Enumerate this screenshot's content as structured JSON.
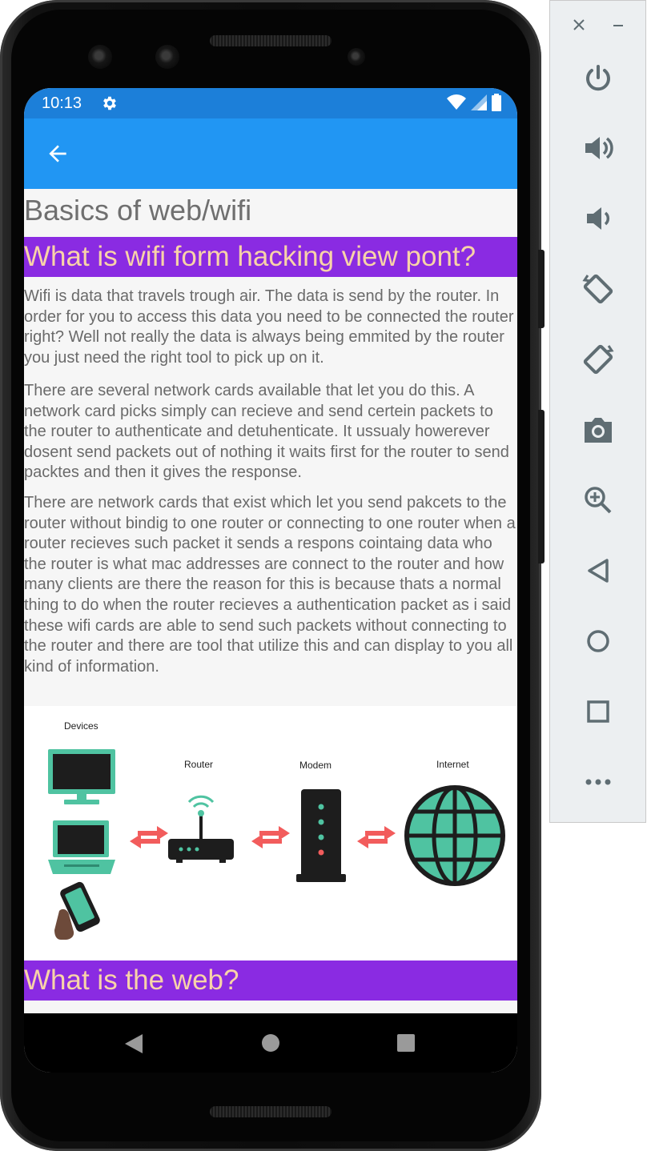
{
  "status_bar": {
    "time": "10:13"
  },
  "content": {
    "page_title": "Basics of web/wifi",
    "sections": [
      {
        "heading": "What is wifi form hacking view pont?",
        "paragraphs": [
          "Wifi is data that travels trough air. The data is send by the router. In order for you to access this data you need to be connected the router right? Well not really the data is always being emmited by the router you just need the right tool to pick up on it.",
          "There are several network cards available that let you do this. A network card picks simply can recieve and send certein packets to the router to authenticate and detuhenticate. It ussualy howerever dosent send packets out of nothing it waits first for the router to send packtes and then it gives the response.",
          "There are network cards that exist which let you send pakcets to the router without bindig to one router or connecting to one router when a router recieves such packet it sends a respons cointaing data who the router is what mac addresses are connect to the router and how many clients are there the reason for this is because thats a normal thing to do when the router recieves a authentication packet as i said these wifi cards are able to send such packets without connecting to the router and there are tool that utilize this and can display to you all kind of information."
        ]
      },
      {
        "heading": "What is the web?"
      }
    ],
    "diagram": {
      "labels": {
        "devices": "Devices",
        "router": "Router",
        "modem": "Modem",
        "internet": "Internet"
      }
    }
  },
  "colors": {
    "status_bar": "#1c7fd9",
    "app_bar": "#2196f3",
    "section_heading_bg": "#8a2be2",
    "section_heading_text": "#f8d3a8",
    "body_text": "#6a6a6a",
    "device_teal": "#4fc3a1",
    "arrow_red": "#f25c5c"
  },
  "icons": {
    "app_bar": "arrow-back-icon",
    "status": [
      "gear-icon",
      "wifi-icon",
      "signal-icon",
      "battery-icon"
    ],
    "nav": [
      "nav-back-icon",
      "nav-home-icon",
      "nav-recents-icon"
    ],
    "emulator_panel": [
      "close-icon",
      "minimize-icon",
      "power-icon",
      "volume-up-icon",
      "volume-down-icon",
      "rotate-left-icon",
      "rotate-right-icon",
      "camera-icon",
      "zoom-icon",
      "back-icon",
      "home-icon",
      "overview-icon",
      "more-icon"
    ]
  }
}
